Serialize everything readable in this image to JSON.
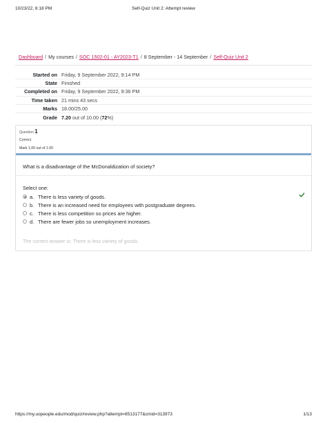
{
  "print_header": {
    "datetime": "10/23/22, 6:18 PM",
    "title": "Self-Quiz Unit 2: Attempt review"
  },
  "breadcrumb": [
    {
      "label": "Dashboard",
      "link": true
    },
    {
      "label": "My courses",
      "link": false
    },
    {
      "label": "SOC 1502-01 - AY2023-T1",
      "link": true
    },
    {
      "label": "8 September - 14 September",
      "link": false
    },
    {
      "label": "Self-Quiz Unit 2",
      "link": true
    }
  ],
  "summary": {
    "started_on_label": "Started on",
    "started_on": "Friday, 9 September 2022, 9:14 PM",
    "state_label": "State",
    "state": "Finished",
    "completed_on_label": "Completed on",
    "completed_on": "Friday, 9 September 2022, 9:36 PM",
    "time_taken_label": "Time taken",
    "time_taken": "21 mins 43 secs",
    "marks_label": "Marks",
    "marks": "18.00/25.00",
    "grade_label": "Grade",
    "grade_value": "7.20",
    "grade_out_of": " out of 10.00 (",
    "grade_percent": "72",
    "grade_suffix": "%)"
  },
  "question": {
    "label": "Question",
    "number": "1",
    "state": "Correct",
    "mark": "Mark 1.00 out of 1.00",
    "text": "What is a disadvantage of the McDonaldization of society?",
    "select_label": "Select one:",
    "options": [
      {
        "letter": "a.",
        "text": "There is less variety of goods.",
        "selected": true,
        "correct": true
      },
      {
        "letter": "b.",
        "text": "There is an increased need for employees with postgraduate degrees.",
        "selected": false
      },
      {
        "letter": "c.",
        "text": "There is less competition so prices are higher.",
        "selected": false
      },
      {
        "letter": "d.",
        "text": "There are fewer jobs so unemployment increases.",
        "selected": false
      }
    ],
    "feedback": "The correct answer is: There is less variety of goods."
  },
  "print_footer": {
    "url": "https://my.uopeople.edu/mod/quiz/review.php?attempt=8513177&cmid=313973",
    "page": "1/13"
  },
  "colors": {
    "link": "#c2185b",
    "info_bar": "#7fa7cf",
    "correct_check": "#2e7d32"
  }
}
